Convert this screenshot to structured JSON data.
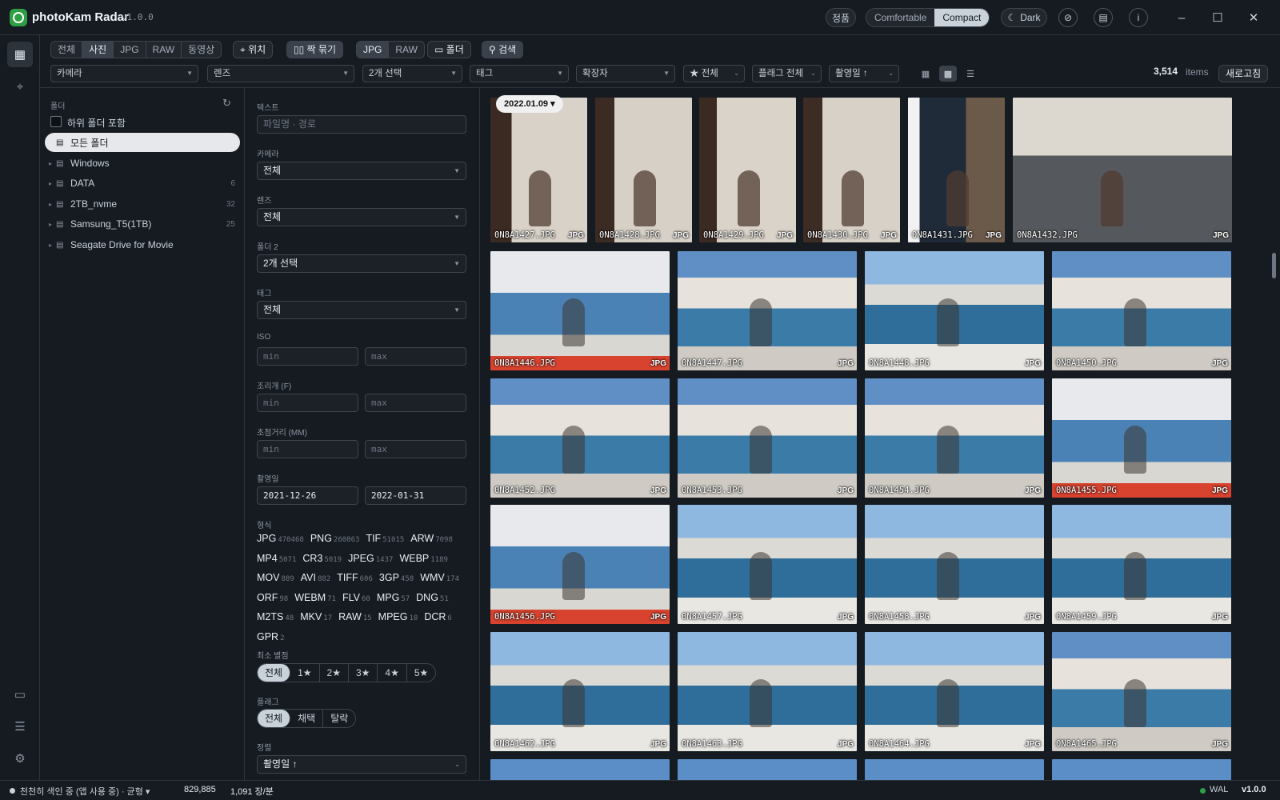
{
  "app": {
    "name": "photoKam Radar",
    "version": "v1.0.0"
  },
  "header": {
    "license": "정품",
    "density": [
      "Comfortable",
      "Compact"
    ],
    "density_selected": 1,
    "theme": "Dark"
  },
  "toolbar": {
    "media_tabs": [
      "전체",
      "사진",
      "JPG",
      "RAW",
      "동영상"
    ],
    "media_selected": 1,
    "location": "위치",
    "pair": "짝 묶기",
    "pair_tabs": [
      "JPG",
      "RAW"
    ],
    "folder": "폴더",
    "search": "검색"
  },
  "filters": {
    "camera": "카메라",
    "lens": "렌즈",
    "folder_sel": "2개 선택",
    "tag": "태그",
    "ext": "확장자",
    "rating": "★ 전체",
    "flag": "플래그 전체",
    "sort": "촬영일 ↑",
    "count": "3,514",
    "count_unit": "items",
    "refresh": "새로고침"
  },
  "folders": {
    "title": "폴더",
    "include_sub": "하위 폴더 포함",
    "items": [
      {
        "label": "모든 폴더",
        "count": ""
      },
      {
        "label": "Windows",
        "count": ""
      },
      {
        "label": "DATA",
        "count": "6"
      },
      {
        "label": "2TB_nvme",
        "count": "32"
      },
      {
        "label": "Samsung_T5(1TB)",
        "count": "25"
      },
      {
        "label": "Seagate Drive for Movie",
        "count": ""
      }
    ]
  },
  "filter_panel": {
    "text_label": "텍스트",
    "text_placeholder": "파일명 · 경로",
    "camera_label": "카메라",
    "camera_value": "전체",
    "lens_label": "렌즈",
    "lens_value": "전체",
    "folder_label": "폴더 2",
    "folder_value": "2개 선택",
    "tag_label": "태그",
    "tag_value": "전체",
    "iso_label": "ISO",
    "aperture_label": "조리개 (F)",
    "focal_label": "초점거리 (MM)",
    "min": "min",
    "max": "max",
    "date_label": "촬영일",
    "date_from": "2021-12-26",
    "date_to": "2022-01-31",
    "format_label": "형식",
    "formats": [
      {
        "name": "JPG",
        "count": "470468"
      },
      {
        "name": "PNG",
        "count": "260863"
      },
      {
        "name": "TIF",
        "count": "51015"
      },
      {
        "name": "ARW",
        "count": "7098"
      },
      {
        "name": "MP4",
        "count": "5071"
      },
      {
        "name": "CR3",
        "count": "5019"
      },
      {
        "name": "JPEG",
        "count": "1437"
      },
      {
        "name": "WEBP",
        "count": "1189"
      },
      {
        "name": "MOV",
        "count": "889"
      },
      {
        "name": "AVI",
        "count": "882"
      },
      {
        "name": "TIFF",
        "count": "606"
      },
      {
        "name": "3GP",
        "count": "458"
      },
      {
        "name": "WMV",
        "count": "174"
      },
      {
        "name": "ORF",
        "count": "98"
      },
      {
        "name": "WEBM",
        "count": "71"
      },
      {
        "name": "FLV",
        "count": "60"
      },
      {
        "name": "MPG",
        "count": "57"
      },
      {
        "name": "DNG",
        "count": "51"
      },
      {
        "name": "M2TS",
        "count": "48"
      },
      {
        "name": "MKV",
        "count": "17"
      },
      {
        "name": "RAW",
        "count": "15"
      },
      {
        "name": "MPEG",
        "count": "10"
      },
      {
        "name": "DCR",
        "count": "6"
      },
      {
        "name": "GPR",
        "count": "2"
      }
    ],
    "rating_label": "최소 별점",
    "ratings": [
      "전체",
      "1★",
      "2★",
      "3★",
      "4★",
      "5★"
    ],
    "flag_label": "플래그",
    "flags": [
      "전체",
      "채택",
      "탈락"
    ],
    "sort_label": "정렬",
    "sort_value": "촬영일 ↑"
  },
  "gallery": {
    "date_group": "2022.01.09 ▾",
    "rows": [
      [
        {
          "name": "0N8A1427.JPG",
          "ext": "JPG"
        },
        {
          "name": "0N8A1428.JPG",
          "ext": "JPG"
        },
        {
          "name": "0N8A1429.JPG",
          "ext": "JPG"
        },
        {
          "name": "0N8A1430.JPG",
          "ext": "JPG"
        },
        {
          "name": "0N8A1431.JPG",
          "ext": "JPG"
        },
        {
          "name": "0N8A1432.JPG",
          "ext": "JPG"
        }
      ],
      [
        {
          "name": "0N8A1446.JPG",
          "ext": "JPG"
        },
        {
          "name": "0N8A1447.JPG",
          "ext": "JPG"
        },
        {
          "name": "0N8A1448.JPG",
          "ext": "JPG"
        },
        {
          "name": "0N8A1450.JPG",
          "ext": "JPG"
        }
      ],
      [
        {
          "name": "0N8A1452.JPG",
          "ext": "JPG"
        },
        {
          "name": "0N8A1453.JPG",
          "ext": "JPG"
        },
        {
          "name": "0N8A1454.JPG",
          "ext": "JPG"
        },
        {
          "name": "0N8A1455.JPG",
          "ext": "JPG"
        }
      ],
      [
        {
          "name": "0N8A1456.JPG",
          "ext": "JPG"
        },
        {
          "name": "0N8A1457.JPG",
          "ext": "JPG"
        },
        {
          "name": "0N8A1458.JPG",
          "ext": "JPG"
        },
        {
          "name": "0N8A1459.JPG",
          "ext": "JPG"
        }
      ],
      [
        {
          "name": "0N8A1462.JPG",
          "ext": "JPG"
        },
        {
          "name": "0N8A1463.JPG",
          "ext": "JPG"
        },
        {
          "name": "0N8A1464.JPG",
          "ext": "JPG"
        },
        {
          "name": "0N8A1465.JPG",
          "ext": "JPG"
        }
      ]
    ]
  },
  "status": {
    "indexing": "천천히 색인 중 (앱 사용 중) · 균형 ▾",
    "indexed": "829,885",
    "rate": "1,091 장/분",
    "db": "WAL",
    "version": "v1.0.0"
  },
  "colors": {
    "accent": "#2ea043",
    "background": "#161b22"
  }
}
